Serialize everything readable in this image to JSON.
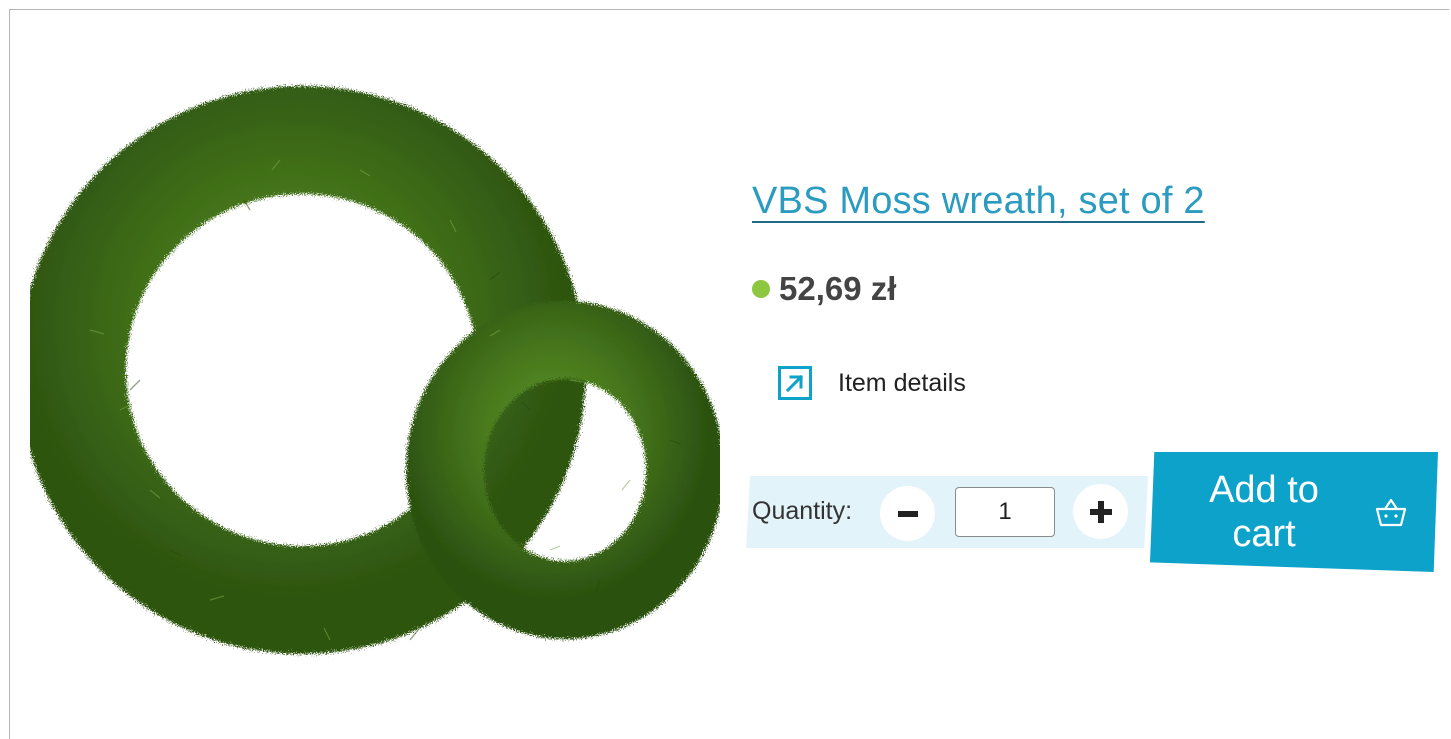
{
  "product": {
    "title": "VBS Moss wreath, set of 2",
    "price": "52,69 zł",
    "stock_status_color": "#8dc63f",
    "image_alt": "Moss wreath set",
    "image_icon": "moss-wreath-image"
  },
  "details_link": {
    "label": "Item details",
    "icon": "external-link-arrow-icon"
  },
  "quantity": {
    "label": "Quantity:",
    "value": "1",
    "minus_icon": "minus-icon",
    "plus_icon": "plus-icon"
  },
  "cart": {
    "label_line1": "Add to",
    "label_line2": "cart",
    "icon": "basket-icon"
  },
  "colors": {
    "accent": "#0da2c9",
    "title_link": "#2b9cc0",
    "quantity_bar": "#e2f3fa",
    "moss_green": "#3c6b1a"
  }
}
